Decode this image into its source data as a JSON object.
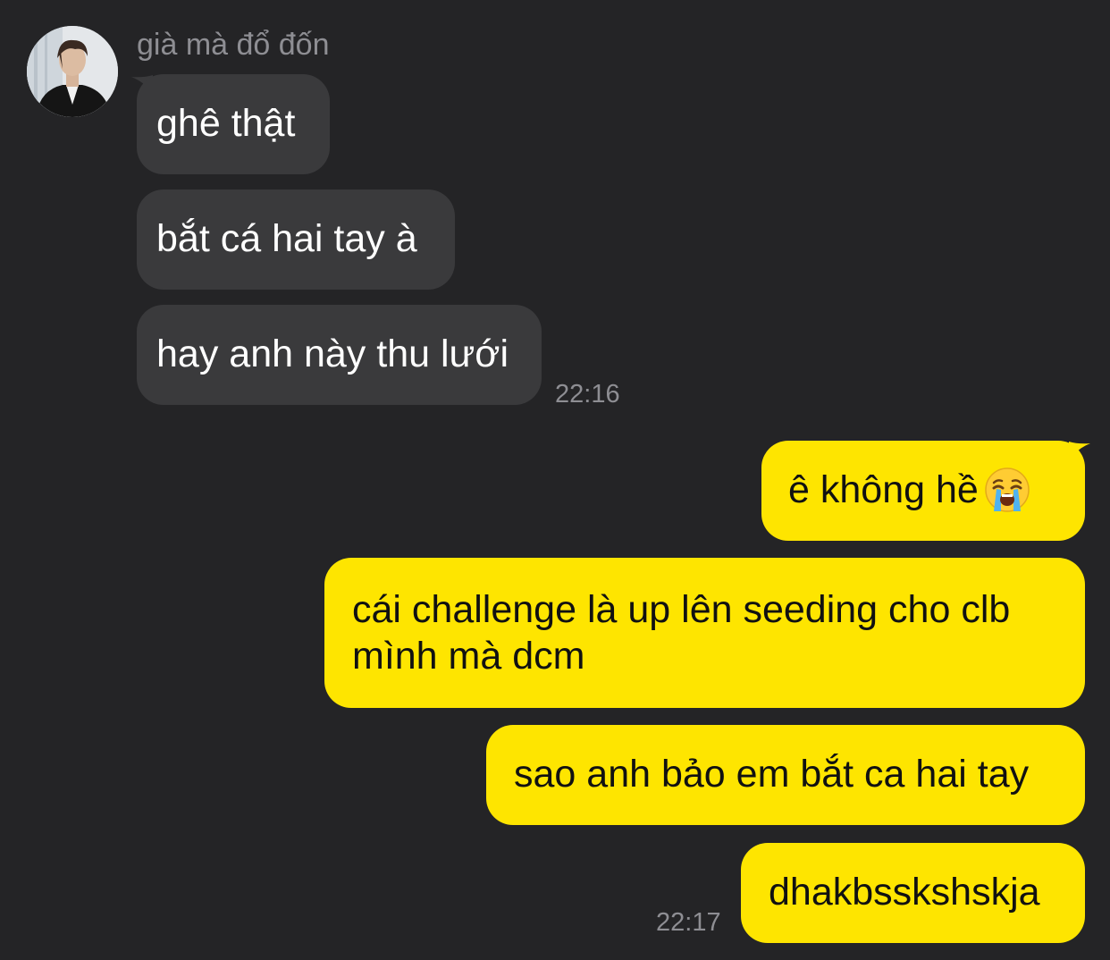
{
  "chat": {
    "sender_name": "già mà đổ đốn",
    "incoming": [
      {
        "text": "ghê thật"
      },
      {
        "text": "bắt cá hai tay à"
      },
      {
        "text": "hay anh này thu lưới"
      }
    ],
    "incoming_time": "22:16",
    "outgoing": [
      {
        "text": "ê không hề",
        "emoji": "loudly-crying-face"
      },
      {
        "line1": "cái challenge là up lên seeding cho clb",
        "line2": "mình mà dcm"
      },
      {
        "text": "sao anh bảo em bắt ca hai tay"
      },
      {
        "text": "dhakbsskshskja"
      }
    ],
    "outgoing_time": "22:17"
  },
  "colors": {
    "background": "#242426",
    "incoming_bubble": "#3a3a3c",
    "outgoing_bubble": "#fee500",
    "timestamp": "#8e8e93"
  }
}
